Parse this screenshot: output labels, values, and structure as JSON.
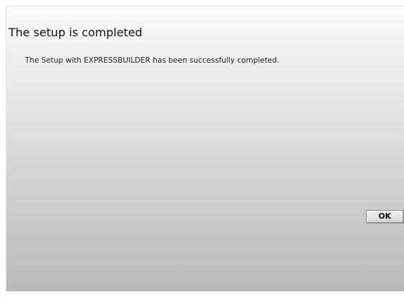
{
  "dialog": {
    "title": "The setup is completed",
    "message": "The Setup with EXPRESSBUILDER has been successfully completed.",
    "ok_label": "OK"
  }
}
